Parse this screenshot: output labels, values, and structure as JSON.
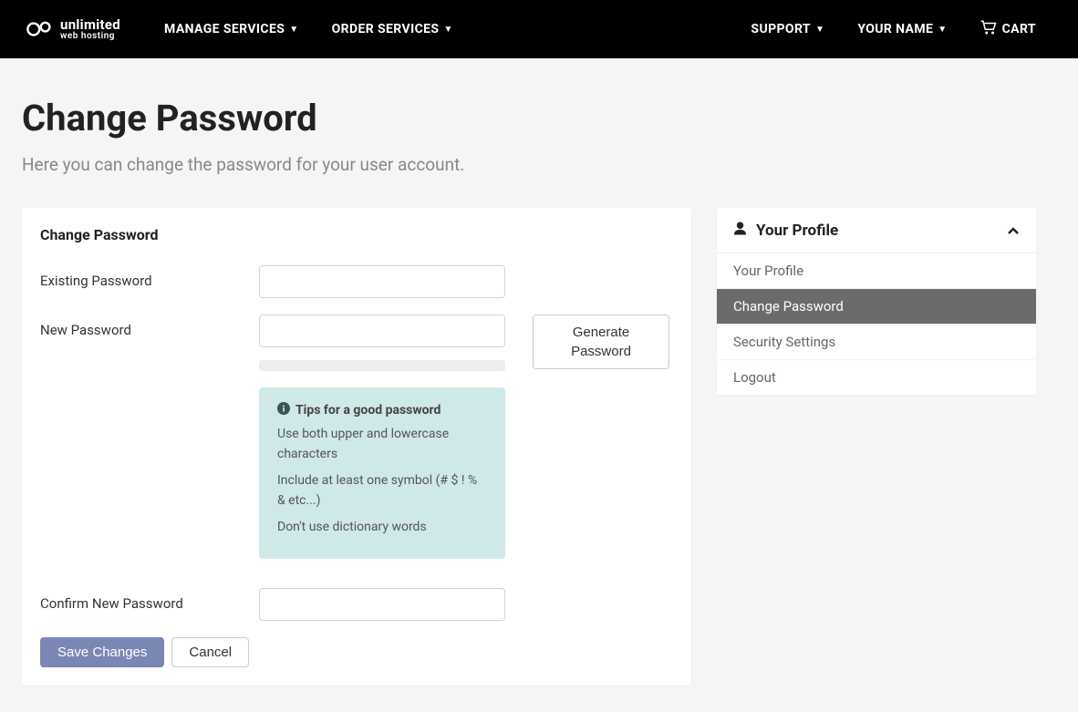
{
  "nav": {
    "logo_top": "unlimited",
    "logo_bottom": "web hosting",
    "left": [
      {
        "label": "MANAGE SERVICES",
        "has_caret": true
      },
      {
        "label": "ORDER SERVICES",
        "has_caret": true
      }
    ],
    "right": [
      {
        "label": "SUPPORT",
        "has_caret": true
      },
      {
        "label": "YOUR NAME",
        "has_caret": true
      }
    ],
    "cart_label": "CART"
  },
  "page": {
    "title": "Change Password",
    "subtitle": "Here you can change the password for your user account."
  },
  "form": {
    "card_title": "Change Password",
    "existing_label": "Existing Password",
    "new_label": "New Password",
    "confirm_label": "Confirm New Password",
    "existing_value": "",
    "new_value": "",
    "confirm_value": "",
    "generate_label": "Generate Password",
    "tips_title": "Tips for a good password",
    "tip1": "Use both upper and lowercase characters",
    "tip2": "Include at least one symbol (# $ ! % & etc...)",
    "tip3": "Don't use dictionary words",
    "save_label": "Save Changes",
    "cancel_label": "Cancel"
  },
  "sidebar": {
    "title": "Your Profile",
    "items": [
      {
        "label": "Your Profile",
        "active": false
      },
      {
        "label": "Change Password",
        "active": true
      },
      {
        "label": "Security Settings",
        "active": false
      },
      {
        "label": "Logout",
        "active": false
      }
    ]
  }
}
